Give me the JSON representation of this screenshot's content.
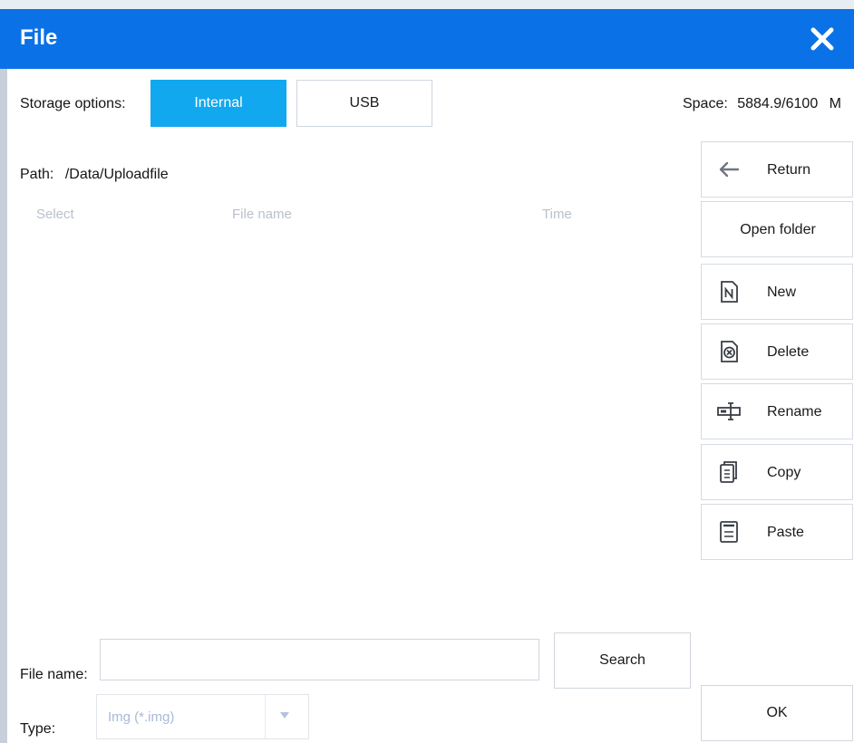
{
  "window": {
    "title": "File"
  },
  "storage": {
    "label": "Storage options:",
    "options": [
      "Internal",
      "USB"
    ],
    "selected": "Internal",
    "space_label": "Space:",
    "space_value": "5884.9/6100",
    "space_unit": "M"
  },
  "path": {
    "label": "Path:",
    "value": "/Data/Uploadfile"
  },
  "table": {
    "columns": [
      "Select",
      "File name",
      "Time"
    ],
    "rows": []
  },
  "actions": {
    "return": "Return",
    "open_folder": "Open folder",
    "new": "New",
    "delete": "Delete",
    "rename": "Rename",
    "copy": "Copy",
    "paste": "Paste",
    "ok": "OK"
  },
  "search": {
    "label": "File name:",
    "value": "",
    "placeholder": "",
    "button": "Search"
  },
  "type": {
    "label": "Type:",
    "selected": "Img (*.img)"
  },
  "icons": {
    "close": "close-icon",
    "return": "arrow-left-icon",
    "new": "new-file-icon",
    "delete": "delete-file-icon",
    "rename": "rename-icon",
    "copy": "copy-icon",
    "paste": "paste-icon",
    "dropdown": "chevron-down-icon"
  },
  "colors": {
    "titlebar": "#0a72e6",
    "active_option": "#11a8ef"
  }
}
